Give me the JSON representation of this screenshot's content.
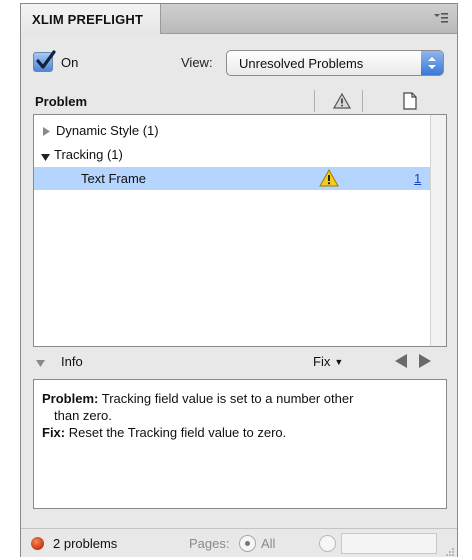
{
  "panel": {
    "title": "XLIM PREFLIGHT",
    "menu_icon": "panel-menu-icon"
  },
  "controls": {
    "on_label": "On",
    "on_checked": true,
    "view_label": "View:",
    "view_value": "Unresolved Problems"
  },
  "list": {
    "header": {
      "problem": "Problem"
    },
    "rows": [
      {
        "label": "Dynamic Style  (1)",
        "expanded": false
      },
      {
        "label": "Tracking (1)",
        "expanded": true
      },
      {
        "label": "Text Frame",
        "page": "1",
        "selected": true
      }
    ]
  },
  "info": {
    "label": "Info",
    "fix_label": "Fix",
    "problem_label": "Problem:",
    "problem_text": "Tracking field value is set to a number other",
    "problem_text_2": "than zero.",
    "fix_label_text": "Fix:",
    "fix_text": "Reset the Tracking field value to zero."
  },
  "status": {
    "count": "2 problems",
    "pages_label": "Pages:",
    "all_label": "All",
    "status_color": "#d2421a"
  }
}
